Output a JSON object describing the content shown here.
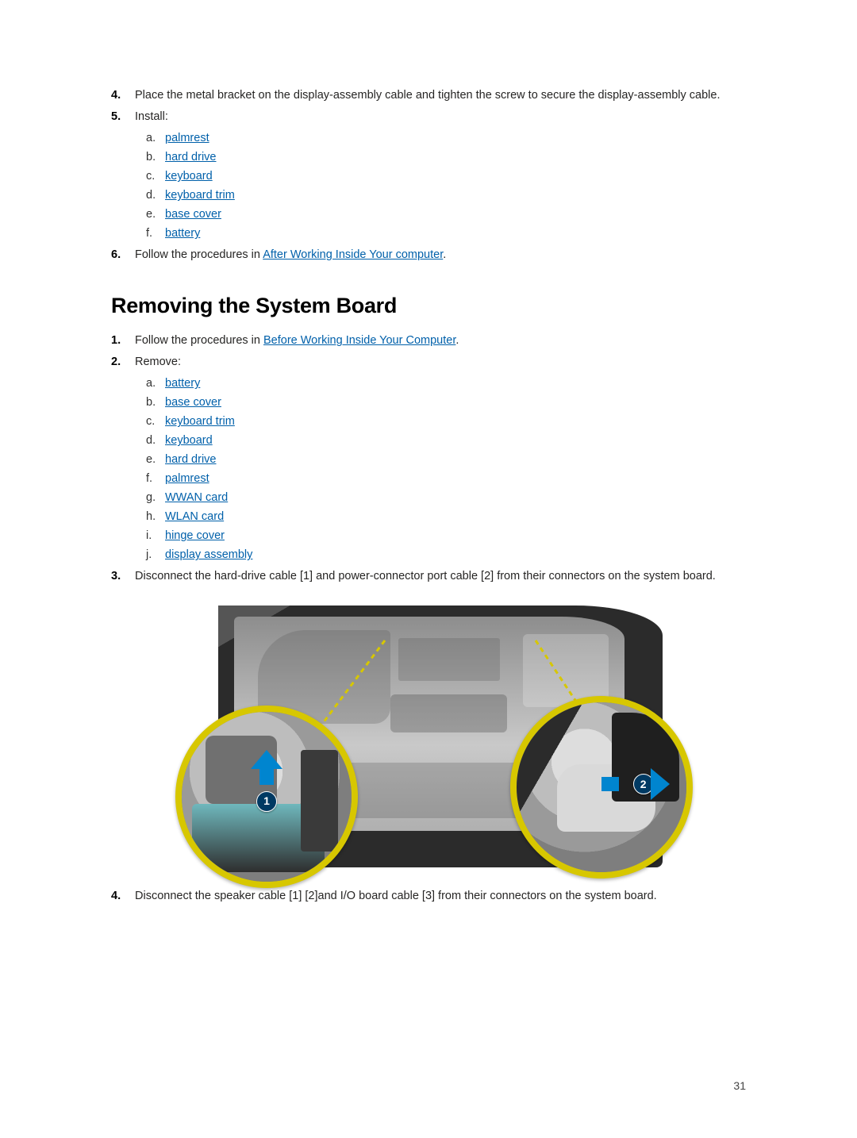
{
  "step4_text": "Place the metal bracket on the display-assembly cable and tighten the screw to secure the display-assembly cable.",
  "step5_text": "Install:",
  "install_items": [
    "palmrest",
    "hard drive",
    "keyboard",
    "keyboard trim",
    "base cover",
    "battery"
  ],
  "step6_prefix": "Follow the procedures in ",
  "step6_link": "After Working Inside Your computer",
  "step6_suffix": ".",
  "heading": "Removing the System Board",
  "r_step1_prefix": "Follow the procedures in ",
  "r_step1_link": "Before Working Inside Your Computer",
  "r_step1_suffix": ".",
  "r_step2_text": "Remove:",
  "remove_items": [
    "battery",
    "base cover",
    "keyboard trim",
    "keyboard",
    "hard drive",
    "palmrest",
    "WWAN card",
    "WLAN card",
    "hinge cover",
    "display assembly"
  ],
  "r_step3_text": "Disconnect the hard-drive cable [1] and power-connector port cable [2] from their connectors on the system board.",
  "r_step4_text": "Disconnect the speaker cable [1] [2]and I/O board cable [3] from their connectors on the system board.",
  "callout1": "1",
  "callout2": "2",
  "page_number": "31"
}
